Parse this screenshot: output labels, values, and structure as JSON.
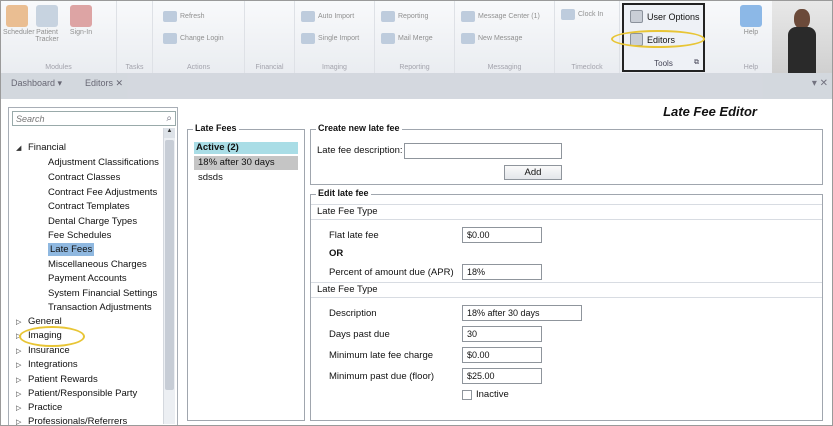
{
  "ribbon": {
    "groups": [
      {
        "label": "Modules",
        "buttons": [
          "Scheduler",
          "Patient Tracker",
          "Sign-In"
        ]
      },
      {
        "label": "Tasks"
      },
      {
        "label": "Actions",
        "buttons": [
          "Refresh",
          "Change Login"
        ]
      },
      {
        "label": "Financial"
      },
      {
        "label": "Imaging",
        "buttons": [
          "Auto Import",
          "Single Import"
        ]
      },
      {
        "label": "Reporting",
        "buttons": [
          "Reporting",
          "Mail Merge"
        ]
      },
      {
        "label": "Messaging",
        "buttons": [
          "Message Center (1)",
          "New Message"
        ]
      },
      {
        "label": "Timeclock",
        "buttons": [
          "Clock In"
        ]
      },
      {
        "label": "Help",
        "buttons": [
          "Help"
        ]
      }
    ],
    "tools": {
      "label": "Tools",
      "user_options": "User Options",
      "editors": "Editors"
    }
  },
  "tabs": [
    {
      "label": "Dashboard"
    },
    {
      "label": "Editors"
    }
  ],
  "editor_title": "Late Fee Editor",
  "search": {
    "placeholder": "Search"
  },
  "tree": {
    "financial": "Financial",
    "financial_children": [
      "Adjustment Classifications",
      "Contract Classes",
      "Contract Fee Adjustments",
      "Contract Templates",
      "Dental Charge Types",
      "Fee Schedules",
      "Late Fees",
      "Miscellaneous Charges",
      "Payment Accounts",
      "System Financial Settings",
      "Transaction Adjustments"
    ],
    "collapsed": [
      "General",
      "Imaging",
      "Insurance",
      "Integrations",
      "Patient Rewards",
      "Patient/Responsible Party",
      "Practice",
      "Professionals/Referrers"
    ]
  },
  "late_fees": {
    "legend": "Late Fees",
    "active_header": "Active (2)",
    "items": [
      "18% after 30 days",
      "sdsds"
    ]
  },
  "create": {
    "legend": "Create new late fee",
    "description_label": "Late fee description:",
    "description_value": "",
    "add_label": "Add"
  },
  "edit": {
    "legend": "Edit late fee",
    "type_header_1": "Late Fee Type",
    "flat_label": "Flat late fee",
    "flat_value": "$0.00",
    "or_label": "OR",
    "percent_label": "Percent of amount due (APR)",
    "percent_value": "18%",
    "type_header_2": "Late Fee Type",
    "description_label": "Description",
    "description_value": "18% after 30 days",
    "days_label": "Days past due",
    "days_value": "30",
    "min_charge_label": "Minimum late fee charge",
    "min_charge_value": "$0.00",
    "min_past_due_label": "Minimum past due (floor)",
    "min_past_due_value": "$25.00",
    "inactive_label": "Inactive",
    "inactive_checked": false
  },
  "colors": {
    "highlight_circle": "#e8c535",
    "active_header": "#a9dde6",
    "tree_selected": "#8fb8e0"
  }
}
